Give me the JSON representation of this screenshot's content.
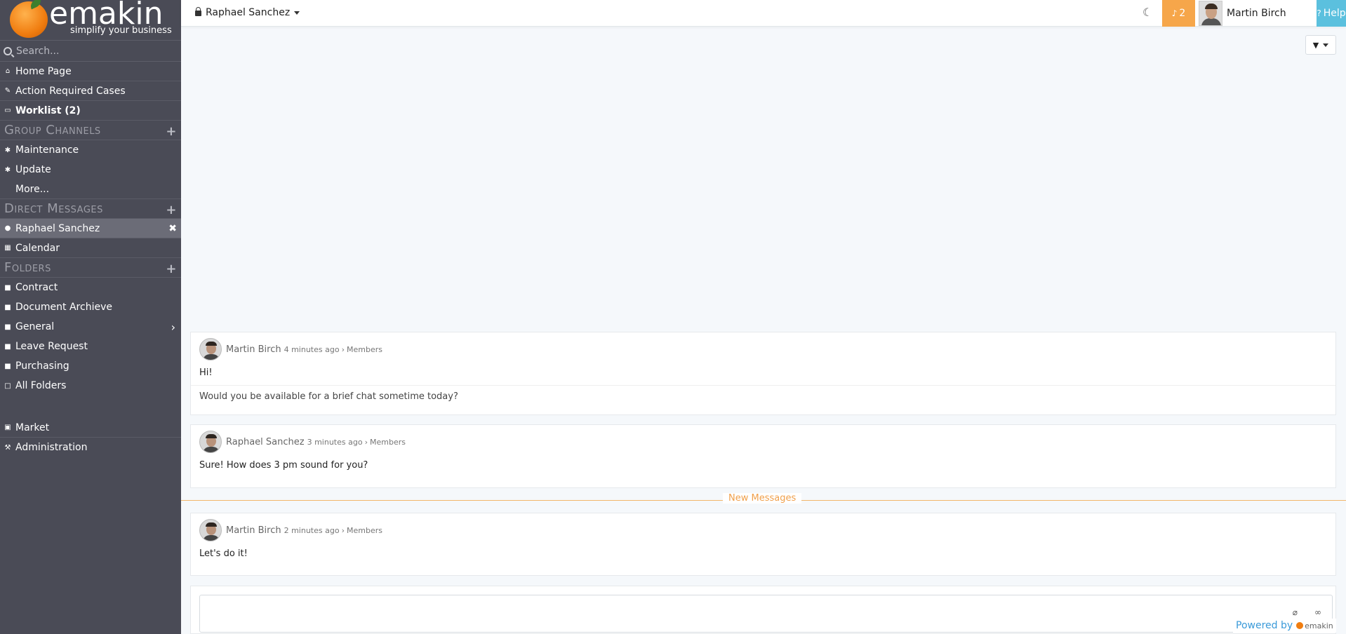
{
  "brand": {
    "name": "emakin",
    "tagline": "simplify your business"
  },
  "search": {
    "placeholder": "Search..."
  },
  "nav": {
    "home": "Home Page",
    "action_required": "Action Required Cases",
    "worklist": "Worklist (2)"
  },
  "group_channels": {
    "title": "Group Channels",
    "items": [
      "Maintenance",
      "Update",
      "More..."
    ]
  },
  "direct_messages": {
    "title": "Direct Messages",
    "items": [
      "Raphael Sanchez",
      "Calendar"
    ]
  },
  "folders": {
    "title": "Folders",
    "items": [
      "Contract",
      "Document Archieve",
      "General",
      "Leave Request",
      "Purchasing",
      "All Folders"
    ]
  },
  "bottom_nav": {
    "market": "Market",
    "administration": "Administration"
  },
  "header": {
    "channel": "Raphael Sanchez",
    "notifications": "2",
    "user": "Martin Birch",
    "help": "Help"
  },
  "messages": [
    {
      "author": "Martin Birch",
      "time": "4 minutes ago",
      "audience": "Members",
      "lines": [
        "Hi!",
        "Would you be available for a brief chat sometime today?"
      ]
    },
    {
      "author": "Raphael Sanchez",
      "time": "3 minutes ago",
      "audience": "Members",
      "lines": [
        "Sure! How does 3 pm sound for you?"
      ]
    },
    {
      "author": "Martin Birch",
      "time": "2 minutes ago",
      "audience": "Members",
      "lines": [
        "Let's do it!"
      ]
    }
  ],
  "new_messages_label": "New Messages",
  "footer": {
    "powered_by": "Powered by",
    "logo_text": "emakin"
  }
}
